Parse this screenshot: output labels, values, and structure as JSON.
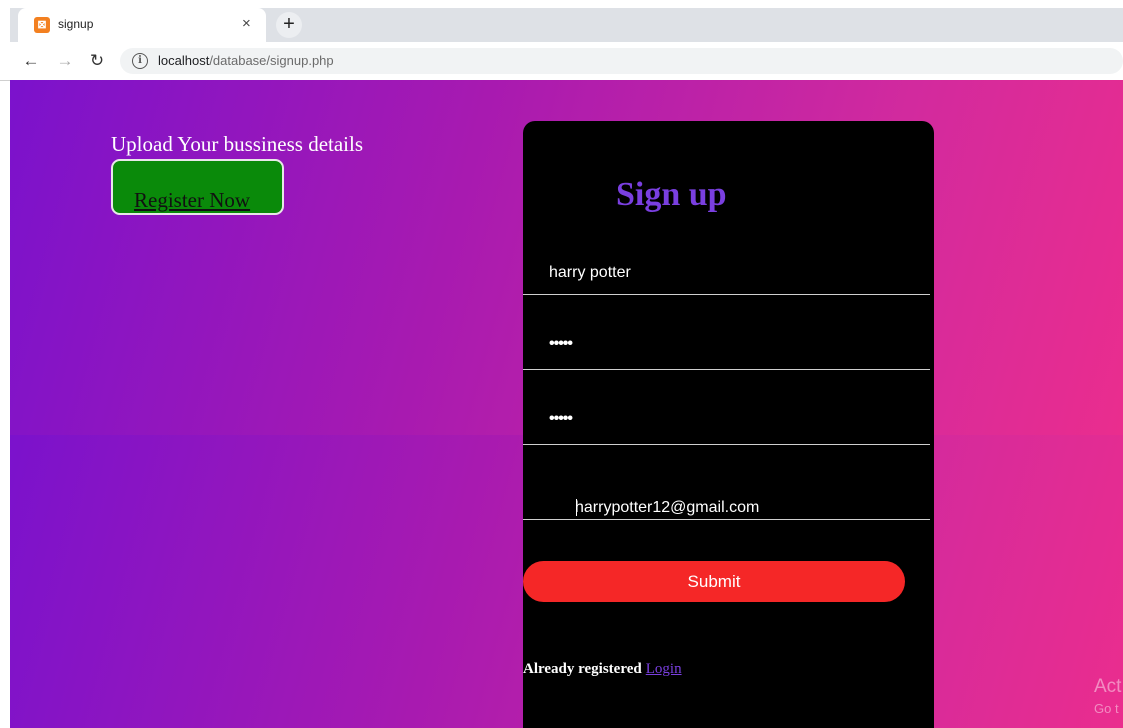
{
  "browser": {
    "tab_title": "signup",
    "tab_close": "×",
    "new_tab": "+",
    "url_host": "localhost",
    "url_path": "/database/signup.php"
  },
  "page": {
    "upload_text": "Upload Your bussiness details",
    "register_label": "Register Now",
    "form": {
      "title": "Sign up",
      "name_value": "harry potter",
      "password_value": "•••••",
      "confirm_password_value": "•••••",
      "email_value": "harrypotter12@gmail.com",
      "submit_label": "Submit",
      "already_text": "Already registered",
      "login_label": "Login"
    },
    "watermark": {
      "line1": "Act",
      "line2": "Go t"
    }
  },
  "colors": {
    "gradient_start": "#7b12cc",
    "gradient_end": "#ea2d8e",
    "register_bg": "#0a8a0a",
    "card_bg": "#000000",
    "title_color": "#7a3fe0",
    "submit_bg": "#f52727"
  },
  "icons": {
    "favicon": "xampp-icon",
    "back": "arrow-left-icon",
    "forward": "arrow-right-icon",
    "reload": "reload-icon",
    "info": "info-icon"
  }
}
